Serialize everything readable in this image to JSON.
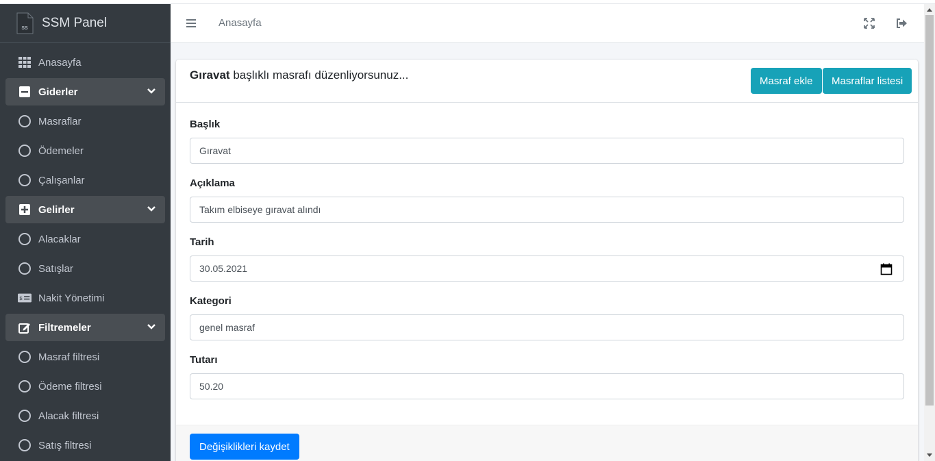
{
  "brand": {
    "title": "SSM Panel",
    "logo_text": "SS"
  },
  "sidebar": {
    "items": [
      {
        "label": "Anasayfa",
        "icon": "grid-icon"
      },
      {
        "label": "Giderler",
        "icon": "minus-square-icon",
        "group": true
      },
      {
        "label": "Masraflar",
        "icon": "circle-icon"
      },
      {
        "label": "Ödemeler",
        "icon": "circle-icon"
      },
      {
        "label": "Çalışanlar",
        "icon": "circle-icon"
      },
      {
        "label": "Gelirler",
        "icon": "plus-square-icon",
        "group": true
      },
      {
        "label": "Alacaklar",
        "icon": "circle-icon"
      },
      {
        "label": "Satışlar",
        "icon": "circle-icon"
      },
      {
        "label": "Nakit Yönetimi",
        "icon": "money-bill-icon"
      },
      {
        "label": "Filtremeler",
        "icon": "edit-icon",
        "group": true
      },
      {
        "label": "Masraf filtresi",
        "icon": "circle-icon"
      },
      {
        "label": "Ödeme filtresi",
        "icon": "circle-icon"
      },
      {
        "label": "Alacak filtresi",
        "icon": "circle-icon"
      },
      {
        "label": "Satış filtresi",
        "icon": "circle-icon"
      }
    ]
  },
  "topbar": {
    "breadcrumb": "Anasayfa"
  },
  "card": {
    "title_bold": "Gıravat",
    "title_rest": " başlıklı masrafı düzenliyorsunuz...",
    "add_button": "Masraf ekle",
    "list_button": "Masraflar listesi",
    "save_button": "Değişiklikleri kaydet"
  },
  "form": {
    "title": {
      "label": "Başlık",
      "value": "Gıravat"
    },
    "description": {
      "label": "Açıklama",
      "value": "Takım elbiseye gıravat alındı"
    },
    "date": {
      "label": "Tarih",
      "value": "30.05.2021"
    },
    "category": {
      "label": "Kategori",
      "value": "genel masraf"
    },
    "amount": {
      "label": "Tutarı",
      "value": "50.20"
    }
  },
  "colors": {
    "sidebar_bg": "#343a40",
    "info": "#17a2b8",
    "primary": "#007bff"
  }
}
